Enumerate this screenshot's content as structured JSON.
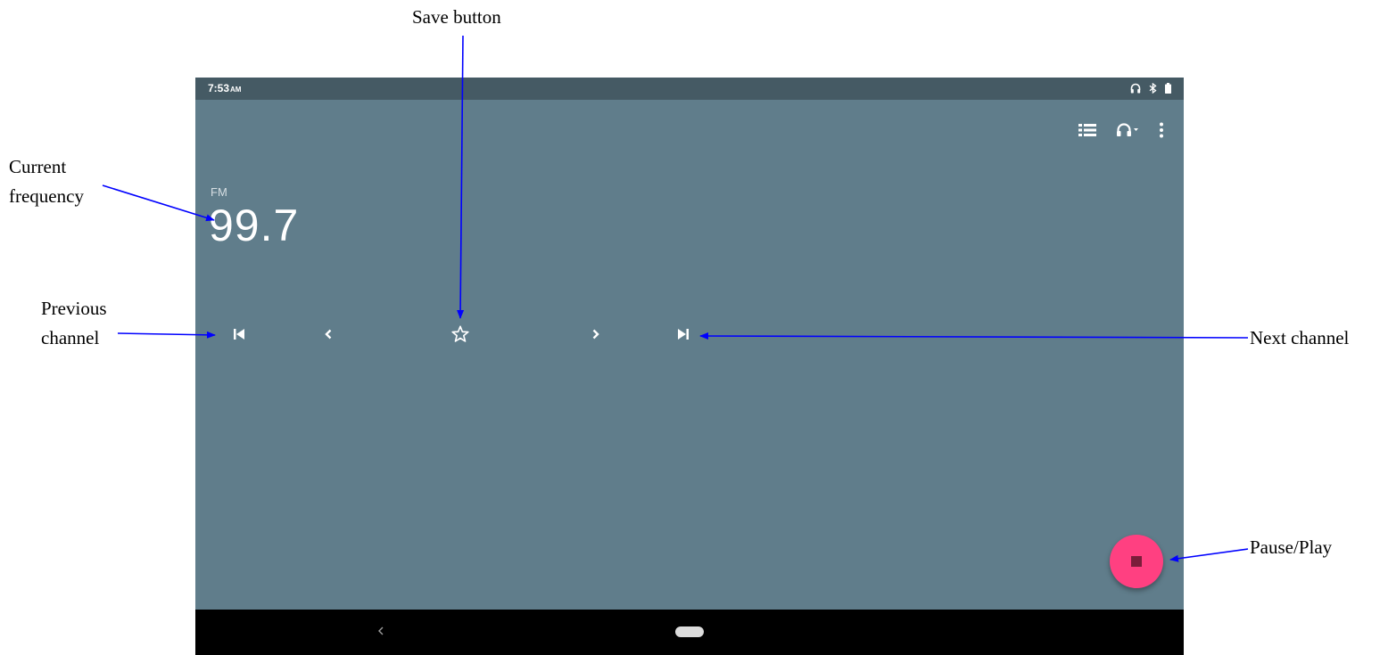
{
  "status_bar": {
    "time": "7:53",
    "ampm": "AM",
    "icons": [
      "headset-icon",
      "bluetooth-icon",
      "battery-icon"
    ]
  },
  "toolbar": {
    "icons": [
      "station-list-icon",
      "audio-output-headset-icon",
      "more-options-icon"
    ]
  },
  "radio": {
    "band": "FM",
    "frequency": "99.7"
  },
  "controls": {
    "icons": [
      "skip-previous-icon",
      "chevron-left-icon",
      "star-outline-icon",
      "chevron-right-icon",
      "skip-next-icon"
    ]
  },
  "fab": {
    "icon": "stop-icon",
    "color": "#ff4081"
  },
  "nav_bar": {
    "icons": [
      "back-icon",
      "home-pill-icon"
    ]
  },
  "annotations": {
    "save_button": "Save button",
    "current_frequency_line1": "Current",
    "current_frequency_line2": "frequency",
    "previous_channel_line1": "Previous",
    "previous_channel_line2": "channel",
    "next_channel": "Next channel",
    "pause_play": "Pause/Play"
  },
  "colors": {
    "screen_bg": "#607d8b",
    "status_bar_bg": "#455a64",
    "nav_bar_bg": "#000000",
    "arrow": "#0000ff"
  }
}
